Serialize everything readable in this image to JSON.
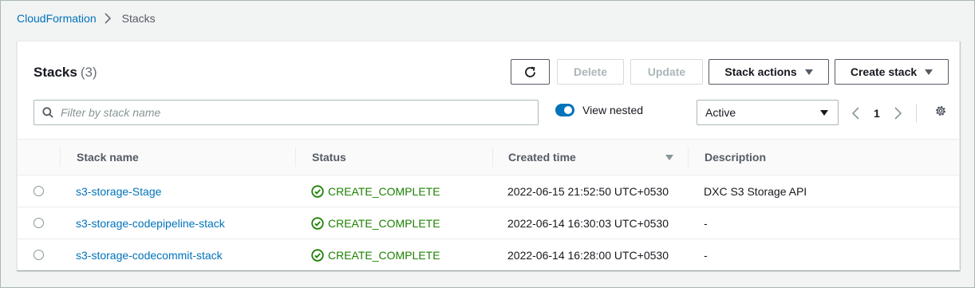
{
  "breadcrumb": {
    "root": "CloudFormation",
    "current": "Stacks"
  },
  "header": {
    "title": "Stacks",
    "count": "(3)"
  },
  "toolbar": {
    "delete_label": "Delete",
    "update_label": "Update",
    "actions_label": "Stack actions",
    "create_label": "Create stack"
  },
  "filter": {
    "placeholder": "Filter by stack name",
    "value": ""
  },
  "view_nested": {
    "label": "View nested",
    "enabled": true
  },
  "status_filter": {
    "selected": "Active"
  },
  "pagination": {
    "page": "1"
  },
  "table": {
    "columns": [
      "Stack name",
      "Status",
      "Created time",
      "Description"
    ],
    "rows": [
      {
        "name": "s3-storage-Stage",
        "status": "CREATE_COMPLETE",
        "created": "2022-06-15 21:52:50 UTC+0530",
        "description": "DXC S3 Storage API"
      },
      {
        "name": "s3-storage-codepipeline-stack",
        "status": "CREATE_COMPLETE",
        "created": "2022-06-14 16:30:03 UTC+0530",
        "description": "-"
      },
      {
        "name": "s3-storage-codecommit-stack",
        "status": "CREATE_COMPLETE",
        "created": "2022-06-14 16:28:00 UTC+0530",
        "description": "-"
      }
    ]
  },
  "colors": {
    "link": "#0073bb",
    "success": "#1d8102",
    "text": "#16191f",
    "muted": "#545b64"
  },
  "icons": [
    "chevron-right-icon",
    "refresh-icon",
    "caret-down-icon",
    "search-icon",
    "chevron-left-icon",
    "gear-icon",
    "success-check-icon"
  ]
}
